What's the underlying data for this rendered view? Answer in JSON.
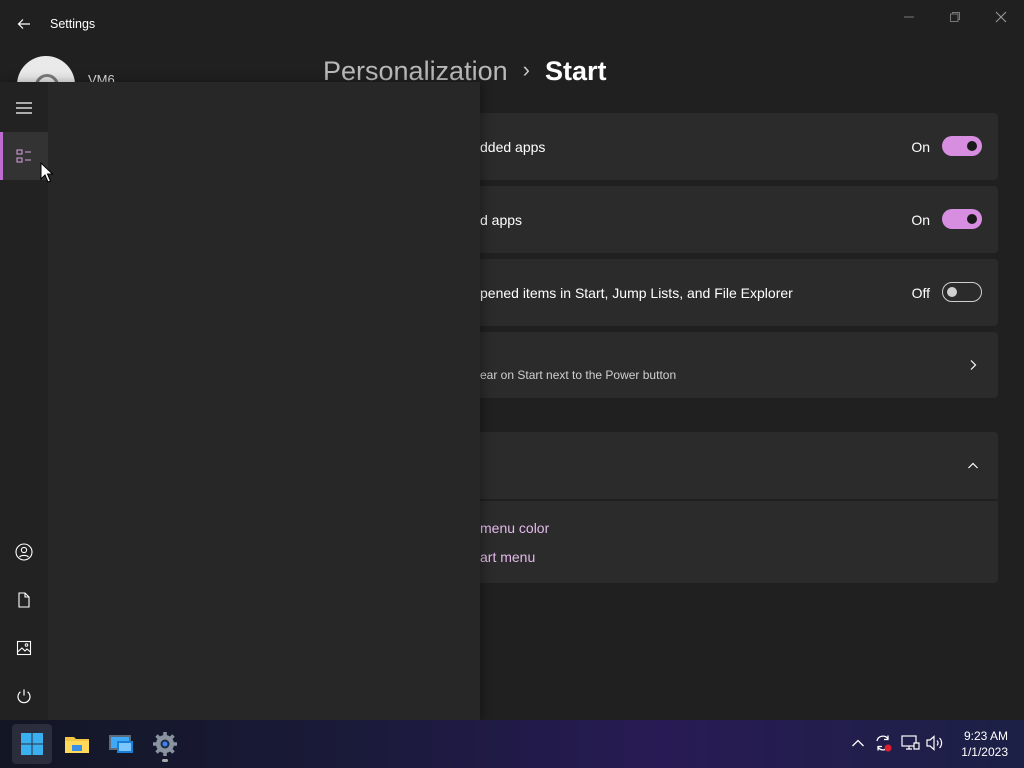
{
  "window": {
    "title": "Settings"
  },
  "account": {
    "name": "VM6"
  },
  "header": {
    "breadcrumb_parent": "Personalization",
    "breadcrumb_current": "Start"
  },
  "settings_rows": [
    {
      "label": "dded apps",
      "state": "On"
    },
    {
      "label": "d apps",
      "state": "On"
    },
    {
      "label": "pened items in Start, Jump Lists, and File Explorer",
      "state": "Off"
    },
    {
      "subtitle": "ear on Start next to the Power button"
    }
  ],
  "related": {
    "links": [
      "menu color",
      "art menu"
    ]
  },
  "colors": {
    "accent": "#c06bd0",
    "toggle_on": "#d88ee0",
    "link": "#e3b9ea",
    "card_bg": "#2b2b2b",
    "window_bg": "#202020"
  },
  "flyout_rail": {
    "icons": [
      "hamburger-menu-icon",
      "all-apps-icon",
      "user-icon",
      "document-icon",
      "pictures-icon",
      "power-icon"
    ]
  },
  "taskbar": {
    "apps": [
      "start-icon",
      "file-explorer-icon",
      "remote-desktop-icon",
      "settings-icon"
    ],
    "tray_icons": [
      "chevron-up-icon",
      "sync-alert-icon",
      "network-icon",
      "volume-icon"
    ],
    "time": "9:23 AM",
    "date": "1/1/2023"
  }
}
